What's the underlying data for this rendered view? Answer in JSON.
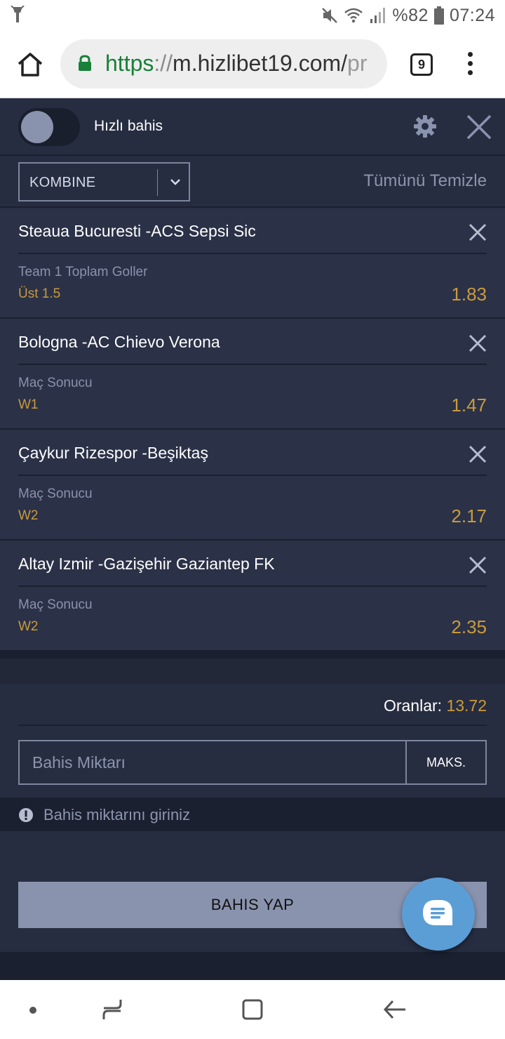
{
  "status_bar": {
    "battery": "%82",
    "time": "07:24",
    "icons": [
      "flashlight-icon",
      "mute-icon",
      "wifi-icon",
      "signal-icon",
      "battery-icon"
    ]
  },
  "browser": {
    "url_scheme": "https",
    "url_sep": "://",
    "url_host": "m.hizlibet19.com/",
    "url_rest": "pr",
    "tab_count": "9"
  },
  "betslip": {
    "quick_bet_label": "Hızlı bahis",
    "bet_type": "KOMBINE",
    "clear_all": "Tümünü Temizle",
    "bets": [
      {
        "match": "Steaua Bucuresti -ACS Sepsi Sic",
        "market": "Team 1 Toplam Goller",
        "pick": "Üst 1.5",
        "odd": "1.83"
      },
      {
        "match": "Bologna -AC Chievo Verona",
        "market": "Maç Sonucu",
        "pick": "W1",
        "odd": "1.47"
      },
      {
        "match": "Çaykur Rizespor -Beşiktaş",
        "market": "Maç Sonucu",
        "pick": "W2",
        "odd": "2.17"
      },
      {
        "match": "Altay Izmir -Gazişehir Gaziantep FK",
        "market": "Maç Sonucu",
        "pick": "W2",
        "odd": "2.35"
      }
    ],
    "odds_label": "Oranlar:",
    "odds_total": "13.72",
    "stake_placeholder": "Bahis Miktarı",
    "max_label": "MAKS.",
    "warning": "Bahis miktarını giriniz",
    "place_bet": "BAHIS YAP"
  },
  "colors": {
    "accent_odds": "#c99b3c",
    "panel": "#2b3147",
    "button": "#8a93ae",
    "fab": "#5b9ed6"
  }
}
